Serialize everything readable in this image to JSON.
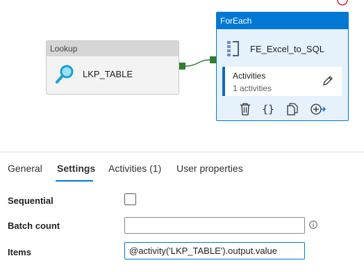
{
  "pipeline": {
    "lookup": {
      "header": "Lookup",
      "name": "LKP_TABLE",
      "icon": "magnifier-icon"
    },
    "foreach": {
      "header": "ForEach",
      "name": "FE_Excel_to_SQL",
      "icon": "foreach-icon",
      "activities_title": "Activities",
      "activities_count": "1 activities",
      "action_icons": [
        "delete-icon",
        "code-icon",
        "copy-icon",
        "add-output-icon"
      ]
    },
    "colors": {
      "accent": "#0078d4",
      "success_port": "#2e7d32",
      "hint_circle": "#e81123"
    }
  },
  "properties": {
    "tabs": [
      {
        "label": "General",
        "active": false
      },
      {
        "label": "Settings",
        "active": true
      },
      {
        "label": "Activities (1)",
        "active": false
      },
      {
        "label": "User properties",
        "active": false
      }
    ],
    "sequential": {
      "label": "Sequential",
      "checked": false
    },
    "batch_count": {
      "label": "Batch count",
      "value": ""
    },
    "items": {
      "label": "Items",
      "value": "@activity('LKP_TABLE').output.value"
    }
  }
}
